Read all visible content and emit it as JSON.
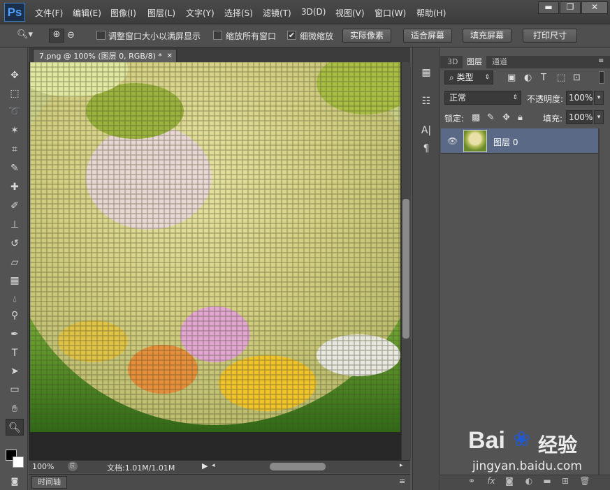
{
  "app": {
    "logo": "Ps"
  },
  "menu": [
    "文件(F)",
    "编辑(E)",
    "图像(I)",
    "图层(L)",
    "文字(Y)",
    "选择(S)",
    "滤镜(T)",
    "3D(D)",
    "视图(V)",
    "窗口(W)",
    "帮助(H)"
  ],
  "window_controls": {
    "minimize": "▬",
    "restore": "❐",
    "close": "✕"
  },
  "options": {
    "resize_windows": "调整窗口大小以满屏显示",
    "zoom_all": "缩放所有窗口",
    "scrubby_zoom": "细微缩放",
    "scrubby_checked": "✔",
    "btn_actual": "实际像素",
    "btn_fit": "适合屏幕",
    "btn_fill": "填充屏幕",
    "btn_print": "打印尺寸"
  },
  "document": {
    "tab_title": "7.png @ 100% (图层 0, RGB/8) *",
    "tab_close": "✕"
  },
  "status": {
    "zoom": "100%",
    "doc_size": "文档:1.01M/1.01M"
  },
  "timeline": {
    "label": "时间轴"
  },
  "panel": {
    "tabs": [
      "3D",
      "图层",
      "通道"
    ],
    "filter_kind": "类型",
    "blend_mode": "正常",
    "opacity_label": "不透明度:",
    "opacity_value": "100%",
    "lock_label": "锁定:",
    "fill_label": "填充:",
    "fill_value": "100%",
    "layers": [
      {
        "name": "图层 0",
        "visible": true
      }
    ]
  },
  "watermark": {
    "brand": "Bai",
    "brand2": "经验",
    "url": "jingyan.baidu.com"
  },
  "colors": {
    "accent": "#5a6a86",
    "chrome": "#535353"
  }
}
